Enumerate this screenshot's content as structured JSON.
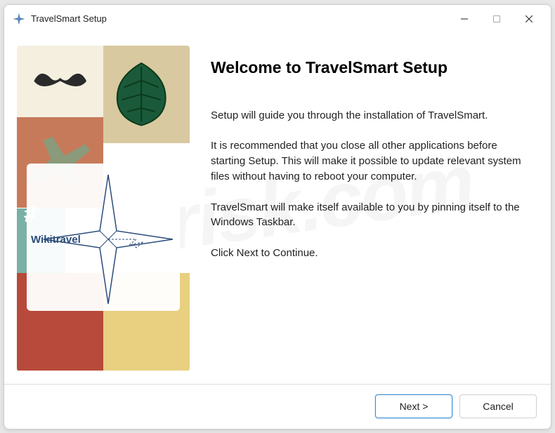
{
  "titlebar": {
    "title": "TravelSmart Setup"
  },
  "sidebar": {
    "logo_text": "Wikitravel",
    "hash": "#"
  },
  "main": {
    "heading": "Welcome to TravelSmart Setup",
    "p1": "Setup will guide you through the installation of TravelSmart.",
    "p2": "It is recommended that you close all other applications before starting Setup.  This will make it possible to update relevant system files without having to reboot your computer.",
    "p3": "TravelSmart will make itself available to you by pinning itself to the Windows Taskbar.",
    "p4": "Click Next to Continue."
  },
  "footer": {
    "next": "Next >",
    "cancel": "Cancel"
  },
  "watermark": "pcrisk.com"
}
